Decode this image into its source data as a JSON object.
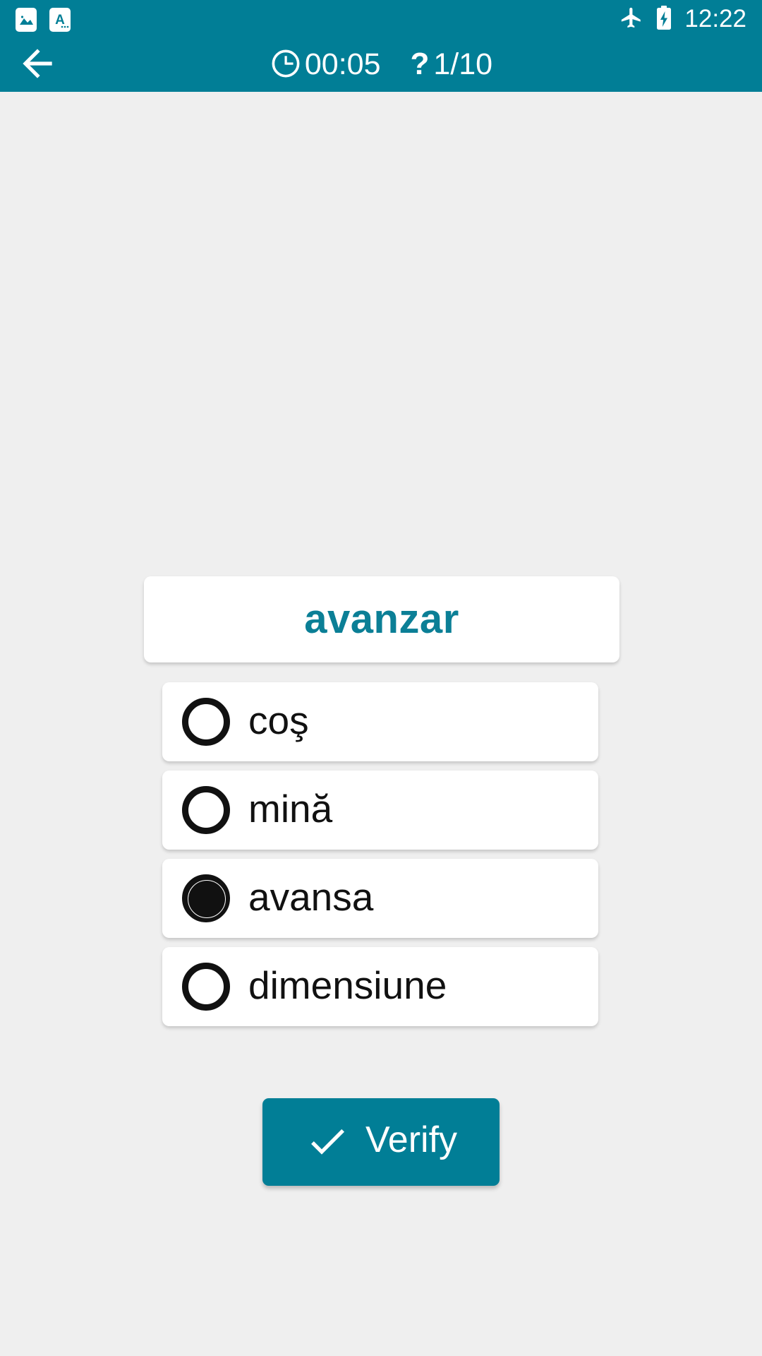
{
  "statusbar": {
    "notifications": [
      {
        "icon": "image-notification-icon"
      },
      {
        "icon": "text-character-notification-icon"
      }
    ],
    "airplane_icon": "airplane-mode-icon",
    "battery_icon": "battery-charging-icon",
    "time": "12:22"
  },
  "appbar": {
    "back_icon": "back-arrow-icon",
    "timer_icon": "clock-icon",
    "timer": "00:05",
    "progress_icon": "question-mark-icon",
    "progress": "1/10",
    "background_color": "#017E96"
  },
  "quiz": {
    "question_word": "avanzar",
    "question_color": "#0B7F96",
    "options": [
      {
        "label": "coş",
        "selected": false
      },
      {
        "label": "mină",
        "selected": false
      },
      {
        "label": "avansa",
        "selected": true
      },
      {
        "label": "dimensiune",
        "selected": false
      }
    ],
    "verify_label": "Verify",
    "verify_icon": "checkmark-icon",
    "verify_color": "#017E96"
  },
  "page": {
    "background_color": "#EFEFEF",
    "card_color": "#FFFFFF"
  }
}
